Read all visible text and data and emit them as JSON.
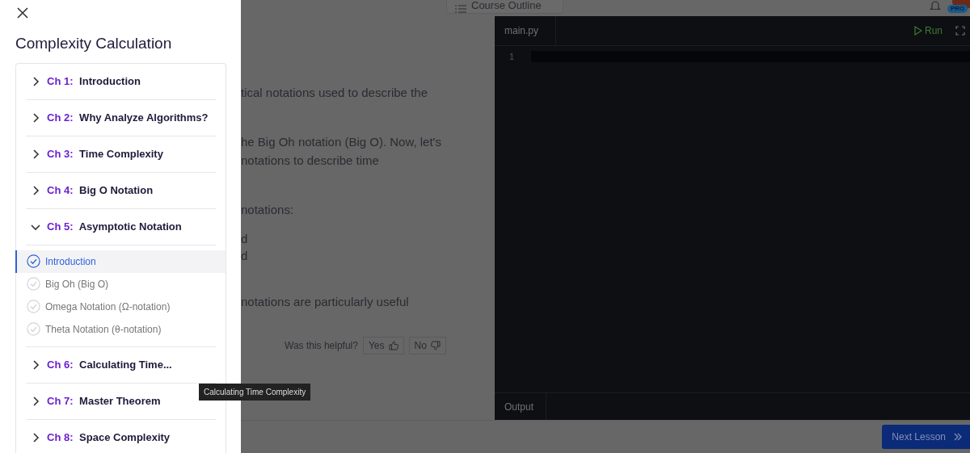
{
  "drawer": {
    "title": "Complexity Calculation",
    "chapters": [
      {
        "number": "Ch 1:",
        "title": "Introduction",
        "expanded": false
      },
      {
        "number": "Ch 2:",
        "title": "Why Analyze Algorithms?",
        "expanded": false
      },
      {
        "number": "Ch 3:",
        "title": "Time Complexity",
        "expanded": false
      },
      {
        "number": "Ch 4:",
        "title": "Big O Notation",
        "expanded": false
      },
      {
        "number": "Ch 5:",
        "title": "Asymptotic Notation",
        "expanded": true,
        "lessons": [
          {
            "title": "Introduction",
            "selected": true
          },
          {
            "title": "Big Oh (Big O)",
            "selected": false
          },
          {
            "title": "Omega Notation (Ω-notation)",
            "selected": false
          },
          {
            "title": "Theta Notation (θ-notation)",
            "selected": false
          }
        ]
      },
      {
        "number": "Ch 6:",
        "title": "Calculating Time...",
        "expanded": false
      },
      {
        "number": "Ch 7:",
        "title": "Master Theorem",
        "expanded": false
      },
      {
        "number": "Ch 8:",
        "title": "Space Complexity",
        "expanded": false
      }
    ]
  },
  "tooltip": {
    "text": "Calculating Time Complexity"
  },
  "page": {
    "course_outline": "Course Outline",
    "badge": "PRO",
    "paragraphs": [
      {
        "kind": "text",
        "lines": [
          "tical notations used to describe the"
        ]
      },
      {
        "kind": "text",
        "lines": [
          "he Big Oh notation (Big O). Now, let's",
          "notations to describe time"
        ]
      },
      {
        "kind": "text",
        "lines": [
          "notations:"
        ]
      },
      {
        "kind": "list",
        "lines": [
          "d",
          "d"
        ]
      },
      {
        "kind": "text",
        "lines": [
          "notations are particularly useful"
        ]
      }
    ],
    "feedback": {
      "question": "Was this helpful?",
      "yes": "Yes",
      "no": "No"
    },
    "editor": {
      "tab": "main.py",
      "run": "Run",
      "line_numbers": [
        "1"
      ],
      "output_tab": "Output"
    },
    "next_button": "Next Lesson"
  }
}
